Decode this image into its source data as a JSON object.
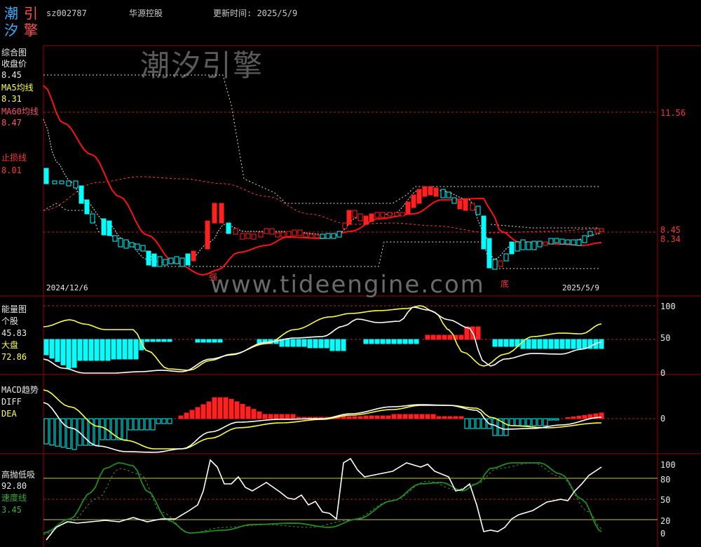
{
  "header": {
    "logo_chars": [
      "潮",
      "引",
      "汐",
      "擎"
    ],
    "code": "sz002787",
    "name": "华源控股",
    "update_label": "更新时间: 2025/5/9"
  },
  "watermark": "潮汐引擎",
  "site_url": "www.tideengine.com",
  "panel_main": {
    "title": "综合图",
    "close_label": "收盘价",
    "close_value": "8.45",
    "ma5_label": "MA5均线",
    "ma5_value": "8.31",
    "ma60_label": "MA60均线",
    "ma60_value": "8.47",
    "stop_label": "止损线",
    "stop_value": "8.01",
    "price_ticks": [
      "11.56",
      "8.45",
      "8.34"
    ],
    "date_start": "2024/12/6",
    "date_end": "2025/5/9",
    "mark_strong": "强",
    "mark_bottom": "底"
  },
  "panel_energy": {
    "title": "能量图",
    "stock_label": "个股",
    "stock_value": "45.83",
    "market_label": "大盘",
    "market_value": "72.86",
    "ticks": [
      "100",
      "50",
      "0"
    ]
  },
  "panel_macd": {
    "title": "MACD趋势",
    "diff_label": "DIFF",
    "dea_label": "DEA",
    "ticks": [
      "0"
    ]
  },
  "panel_oscillator": {
    "title": "高抛低吸",
    "value": "92.80",
    "speed_label": "速度线",
    "speed_value": "3.45",
    "ticks": [
      "100",
      "80",
      "50",
      "20",
      "0"
    ]
  },
  "colors": {
    "up": "#ff2020",
    "down": "#00ffff",
    "ma5": "#ffff40",
    "ma60": "#ff3050",
    "stock": "#ffffff",
    "market": "#ffff40",
    "osc": "#ffffff",
    "speed": "#1e8c1e",
    "grid_red": "#a00000"
  },
  "chart_data": [
    {
      "type": "candlestick",
      "title": "综合图",
      "x_range": [
        "2024/12/6",
        "2025/5/9"
      ],
      "series": [
        {
          "name": "收盘价",
          "last": 8.45
        },
        {
          "name": "MA5均线",
          "last": 8.31
        },
        {
          "name": "MA60均线",
          "last": 8.47
        },
        {
          "name": "止损线",
          "last": 8.01
        }
      ]
    },
    {
      "type": "line",
      "title": "能量图",
      "ylim": [
        0,
        100
      ],
      "series": [
        {
          "name": "个股",
          "last": 45.83
        },
        {
          "name": "大盘",
          "last": 72.86
        }
      ]
    },
    {
      "type": "bar",
      "title": "MACD趋势",
      "series": [
        {
          "name": "DIFF"
        },
        {
          "name": "DEA"
        }
      ]
    },
    {
      "type": "line",
      "title": "高抛低吸",
      "ylim": [
        0,
        100
      ],
      "series": [
        {
          "name": "高抛低吸",
          "last": 92.8
        },
        {
          "name": "速度线",
          "last": 3.45
        }
      ]
    }
  ]
}
